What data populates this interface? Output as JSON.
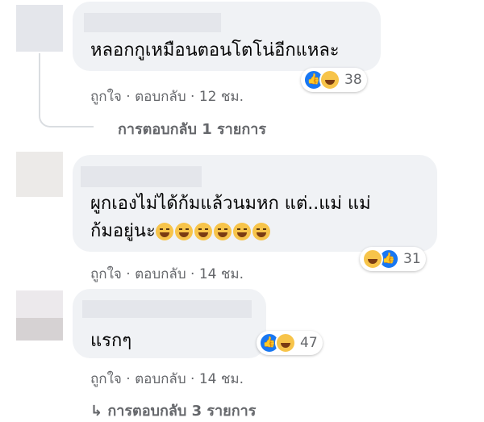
{
  "comments": [
    {
      "text": "หลอกกูเหมือนตอนโตโน่อีกแหละ",
      "reaction_count": "38",
      "like": "ถูกใจ",
      "reply": "ตอบกลับ",
      "time": "12 ชม.",
      "replies_label": "การตอบกลับ 1 รายการ"
    },
    {
      "text_line1": "ผูกเองไม่ได้ก้มแล้วนมหก แต่..แม่ แม่",
      "text_line2": "ก้มอยู่นะ",
      "reaction_count": "31",
      "like": "ถูกใจ",
      "reply": "ตอบกลับ",
      "time": "14 ชม."
    },
    {
      "text": "แรกๆ",
      "reaction_count": "47",
      "like": "ถูกใจ",
      "reply": "ตอบกลับ",
      "time": "14 ชม.",
      "replies_arrow": "↳",
      "replies_label": "การตอบกลับ 3 รายการ"
    }
  ],
  "separator": "·",
  "icons": [
    "like-reaction-icon",
    "haha-reaction-icon",
    "laughing-crying-emoji-icon",
    "reply-arrow-icon"
  ],
  "colors": {
    "bubble": "#f0f2f5",
    "meta": "#65676b",
    "like": "#1877f2",
    "haha": "#f7c44a"
  }
}
